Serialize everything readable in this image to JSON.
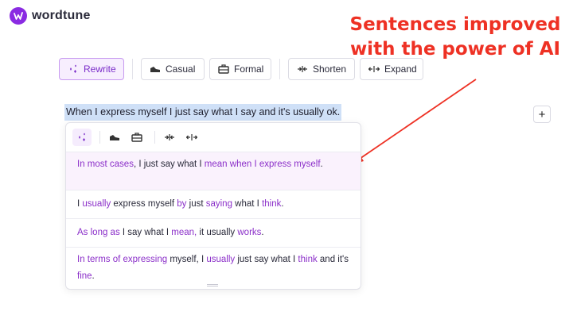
{
  "app": {
    "logo_text": "wordtune"
  },
  "annotation": {
    "line1": "Sentences improved",
    "line2": "with the power of AI"
  },
  "toolbar": {
    "rewrite": "Rewrite",
    "casual": "Casual",
    "formal": "Formal",
    "shorten": "Shorten",
    "expand": "Expand"
  },
  "editor": {
    "sentence": "When I express myself I just say what I say and it's usually ok."
  },
  "colors": {
    "accent": "#8b2fc9",
    "annotation": "#ee3124",
    "selection": "#cfe0f7"
  },
  "suggestions": [
    {
      "parts": [
        {
          "t": "In most cases",
          "hl": true
        },
        {
          "t": ", I just say what I ",
          "hl": false
        },
        {
          "t": "mean when I express myself",
          "hl": true
        },
        {
          "t": ".",
          "hl": false
        }
      ]
    },
    {
      "parts": [
        {
          "t": "I ",
          "hl": false
        },
        {
          "t": "usually",
          "hl": true
        },
        {
          "t": " express myself ",
          "hl": false
        },
        {
          "t": "by",
          "hl": true
        },
        {
          "t": " just ",
          "hl": false
        },
        {
          "t": "saying",
          "hl": true
        },
        {
          "t": " what I ",
          "hl": false
        },
        {
          "t": "think",
          "hl": true
        },
        {
          "t": ".",
          "hl": false
        }
      ]
    },
    {
      "parts": [
        {
          "t": "As long as",
          "hl": true
        },
        {
          "t": " I say what I ",
          "hl": false
        },
        {
          "t": "mean,",
          "hl": true
        },
        {
          "t": " it usually ",
          "hl": false
        },
        {
          "t": "works",
          "hl": true
        },
        {
          "t": ".",
          "hl": false
        }
      ]
    },
    {
      "parts": [
        {
          "t": "In terms of expressing",
          "hl": true
        },
        {
          "t": " myself, I ",
          "hl": false
        },
        {
          "t": "usually",
          "hl": true
        },
        {
          "t": " just say what I ",
          "hl": false
        },
        {
          "t": "think",
          "hl": true
        },
        {
          "t": " and it's ",
          "hl": false
        },
        {
          "t": "fine",
          "hl": true
        },
        {
          "t": ".",
          "hl": false
        }
      ]
    }
  ]
}
